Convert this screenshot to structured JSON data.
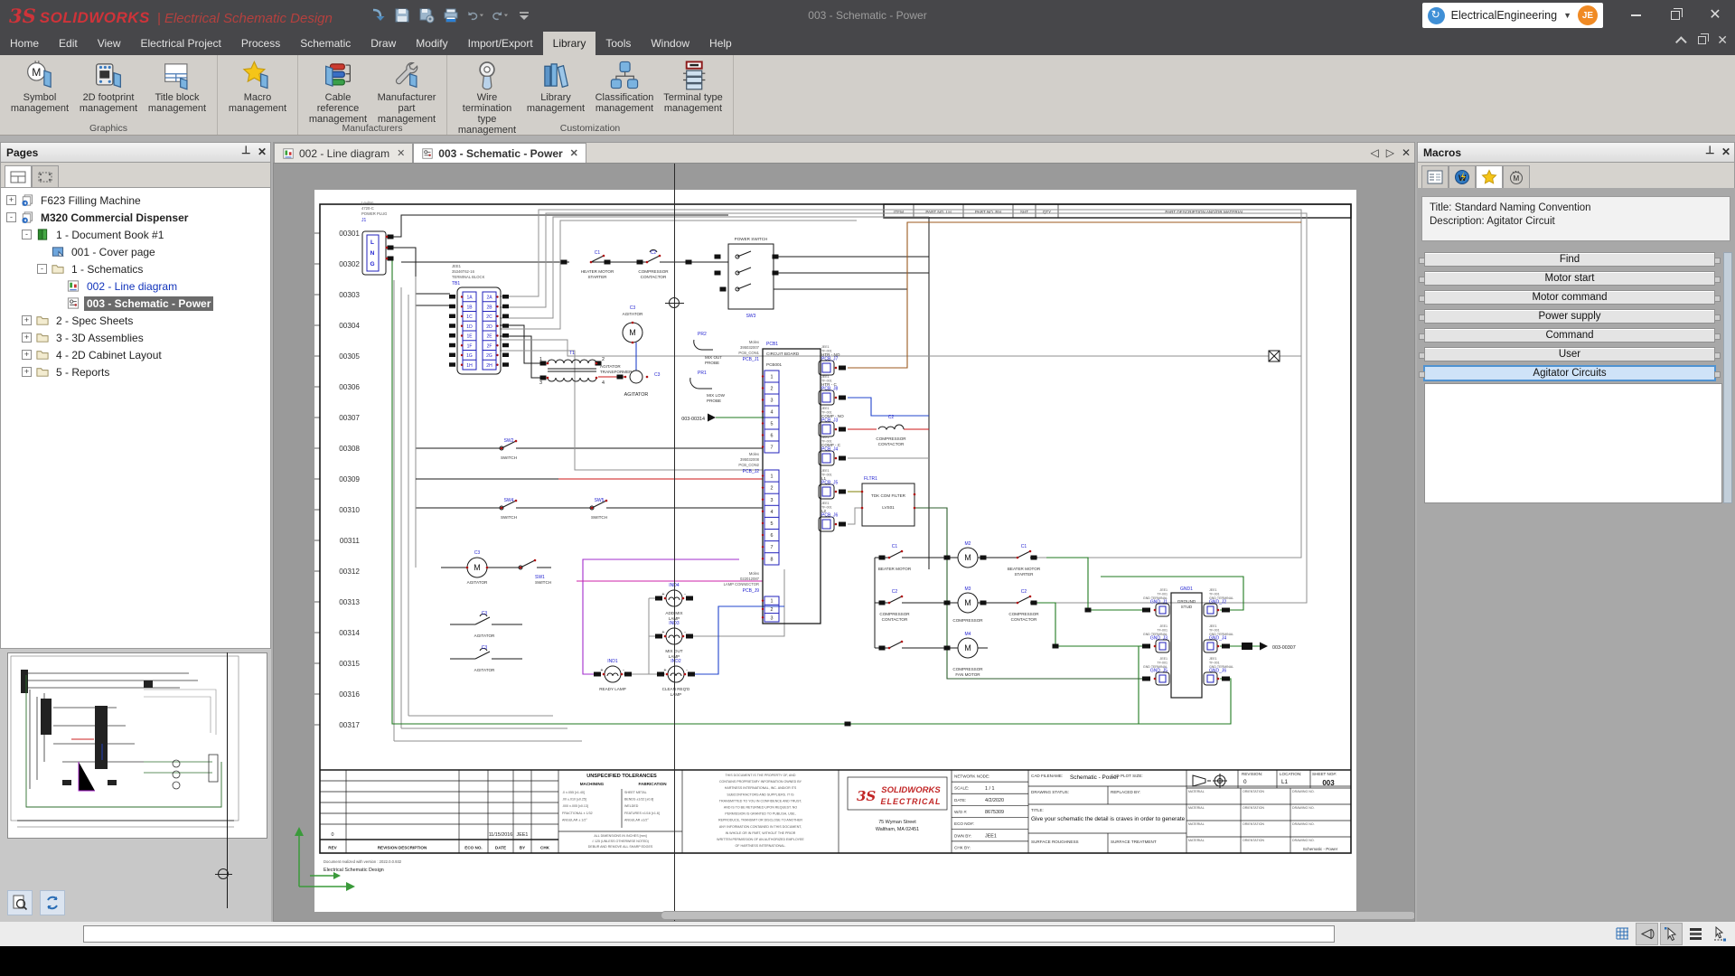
{
  "titlebar": {
    "logo_mark": "3S",
    "brand": "SOLIDWORKS",
    "app_title": "| Electrical Schematic Design",
    "document_title": "003 - Schematic - Power",
    "workspace": "ElectricalEngineering",
    "avatar_initials": "JE",
    "qat": [
      "import",
      "save",
      "save-all",
      "print",
      "undo",
      "redo",
      "customize"
    ]
  },
  "menubar": {
    "items": [
      "Home",
      "Edit",
      "View",
      "Electrical Project",
      "Process",
      "Schematic",
      "Draw",
      "Modify",
      "Import/Export",
      "Library",
      "Tools",
      "Window",
      "Help"
    ],
    "active": "Library"
  },
  "ribbon": {
    "groups": [
      {
        "label": "Graphics",
        "buttons": [
          {
            "line1": "Symbol",
            "line2": "management",
            "icon": "symbol"
          },
          {
            "line1": "2D footprint",
            "line2": "management",
            "icon": "footprint"
          },
          {
            "line1": "Title block",
            "line2": "management",
            "icon": "titleblock"
          }
        ]
      },
      {
        "label": "",
        "buttons": [
          {
            "line1": "Macro",
            "line2": "management",
            "icon": "macro"
          }
        ]
      },
      {
        "label": "Manufacturers",
        "buttons": [
          {
            "line1": "Cable reference",
            "line2": "management",
            "icon": "cable"
          },
          {
            "line1": "Manufacturer",
            "line2": "part management",
            "icon": "wrench"
          }
        ]
      },
      {
        "label": "Customization",
        "buttons": [
          {
            "line1": "Wire termination",
            "line2": "type management",
            "icon": "wireterm"
          },
          {
            "line1": "Library",
            "line2": "management",
            "icon": "library"
          },
          {
            "line1": "Classification",
            "line2": "management",
            "icon": "classification"
          },
          {
            "line1": "Terminal type",
            "line2": "management",
            "icon": "terminal"
          }
        ]
      }
    ]
  },
  "pages_panel": {
    "title": "Pages",
    "tree": [
      {
        "label": "F623 Filling Machine",
        "level": 0,
        "expander": "+",
        "icon": "project"
      },
      {
        "label": "M320 Commercial Dispenser",
        "level": 0,
        "expander": "-",
        "icon": "project",
        "bold": true
      },
      {
        "label": "1 - Document Book #1",
        "level": 1,
        "expander": "-",
        "icon": "book"
      },
      {
        "label": "001 - Cover page",
        "level": 2,
        "expander": "",
        "icon": "cover"
      },
      {
        "label": "1 - Schematics",
        "level": 2,
        "expander": "-",
        "icon": "folder"
      },
      {
        "label": "002 - Line diagram",
        "level": 3,
        "expander": "",
        "icon": "linediag",
        "link": true
      },
      {
        "label": "003 - Schematic - Power",
        "level": 3,
        "expander": "",
        "icon": "schematic",
        "selected": true
      },
      {
        "label": "2 - Spec Sheets",
        "level": 1,
        "expander": "+",
        "icon": "folder"
      },
      {
        "label": "3 - 3D Assemblies",
        "level": 1,
        "expander": "+",
        "icon": "folder"
      },
      {
        "label": "4 - 2D Cabinet Layout",
        "level": 1,
        "expander": "+",
        "icon": "folder"
      },
      {
        "label": "5 - Reports",
        "level": 1,
        "expander": "+",
        "icon": "folder"
      }
    ]
  },
  "document_tabs": [
    {
      "label": "002 - Line diagram",
      "icon": "linediag",
      "active": false
    },
    {
      "label": "003 - Schematic - Power",
      "icon": "schematic",
      "active": true
    }
  ],
  "macros_panel": {
    "title": "Macros",
    "info_title": "Title: Standard Naming Convention",
    "info_description": "Description: Agitator Circuit",
    "buttons": [
      "Find",
      "Motor start",
      "Motor command",
      "Power supply",
      "Command",
      "User",
      "Agitator Circuits"
    ],
    "selected": "Agitator Circuits"
  },
  "statusbar": {
    "command_value": "",
    "tools": [
      {
        "name": "grid",
        "active": false
      },
      {
        "name": "projection",
        "active": true
      },
      {
        "name": "snap-cursor",
        "active": true
      },
      {
        "name": "layers",
        "active": false
      },
      {
        "name": "measure-line",
        "active": false
      }
    ]
  },
  "schematic": {
    "wire_numbers": [
      "00301",
      "00302",
      "00303",
      "00304",
      "00305",
      "00306",
      "00307",
      "00308",
      "00309",
      "00310",
      "00311",
      "00312",
      "00313",
      "00314",
      "00315",
      "00316",
      "00317"
    ],
    "bom_columns": [
      "ITEM",
      "PART NO. LH",
      "PART NO. RH",
      "SHT",
      "QTY",
      "PART DESCRIPTION AND/OR MATERIAL"
    ],
    "motor_letter": "M",
    "polarity": {
      "plus": "+",
      "minus": "-"
    },
    "frame_refs": {
      "ref_in": "003-00314",
      "ref_out": "003-00307"
    },
    "components": {
      "j1": {
        "part": [
          "Leviton",
          "4720-C",
          "POWER PLUG"
        ],
        "ref": "J1",
        "pins": [
          "L",
          "N",
          "G"
        ]
      },
      "tb1": {
        "part": [
          "JEE1",
          "35346T62-16",
          "TERMINAL BLOCK"
        ],
        "ref": "TB1",
        "col1": [
          "1A",
          "1B",
          "1C",
          "1D",
          "1E",
          "1F",
          "1G",
          "1H"
        ],
        "col2": [
          "2A",
          "2B",
          "2C",
          "2D",
          "2E",
          "2F",
          "2G",
          "2H"
        ]
      },
      "c1_starter": {
        "ref": "C1",
        "caption": [
          "HEATER MOTOR",
          "STARTER"
        ]
      },
      "c2_contactor": {
        "ref": "C2",
        "caption": [
          "COMPRESSOR",
          "CONTACTOR"
        ]
      },
      "sw3": {
        "ref": "SW3",
        "caption": "POWER SWITCH"
      },
      "t1": {
        "ref": "T1",
        "caption": [
          "AGITATOR",
          "TRANSFORMER"
        ],
        "pins": [
          "1",
          "2",
          "3",
          "4"
        ]
      },
      "c3_motor": {
        "ref": "C3",
        "caption": "AGITATOR"
      },
      "c3_coil": {
        "ref": "C3",
        "caption": "AGITATOR"
      },
      "c3_contact": {
        "ref": "C3",
        "caption": "AGITATOR"
      },
      "pr2": {
        "ref": "PR2",
        "caption": [
          "MIX OUT",
          "PROBE"
        ]
      },
      "pr1": {
        "ref": "PR1",
        "caption": [
          "MIX LOW",
          "PROBE"
        ]
      },
      "pcb1": {
        "ref": "PCB1",
        "caption": "CIRCUIT BOARD",
        "sub": "PCB001"
      },
      "pcb_con1": {
        "part": [
          "Molex",
          "395032007",
          "PCB_CON1"
        ],
        "ref": "PCB_J1",
        "pins": [
          "1",
          "2",
          "3",
          "4",
          "5",
          "6",
          "7"
        ]
      },
      "pcb_con2": {
        "part": [
          "Molex",
          "395032008",
          "PCB_CON2"
        ],
        "ref": "PCB_J2",
        "pins": [
          "1",
          "2",
          "3",
          "4",
          "5",
          "6",
          "7",
          "8"
        ]
      },
      "lamp_conn": {
        "part": [
          "Molex",
          "022012087",
          "LAMP CONNECTOR"
        ],
        "ref": "PCB_J9",
        "pins": [
          "1",
          "2",
          "3"
        ]
      },
      "pcb_terminals": [
        {
          "part": "JEE1",
          "series": "TF-001",
          "signal": "HTR - NO",
          "ref": "PCB_J7"
        },
        {
          "part": "JEE1",
          "series": "TF-001",
          "signal": "HTR - C",
          "ref": "PCB_J8"
        },
        {
          "part": "JEE1",
          "series": "TF-001",
          "signal": "COMP - NO",
          "ref": "PCB_J3"
        },
        {
          "part": "JEE1",
          "series": "TF-001",
          "signal": "COMP - C",
          "ref": "PCB_J4"
        },
        {
          "part": "JEE1",
          "series": "TF-001",
          "signal": "L1",
          "ref": "PCB_J5"
        },
        {
          "part": "JEE1",
          "series": "TF-001",
          "signal": "L2",
          "ref": "PCB_J6"
        }
      ],
      "c2_coil": {
        "ref": "C2",
        "caption": [
          "COMPRESSOR",
          "CONTACTOR"
        ]
      },
      "fltr1": {
        "ref": "FLTR1",
        "caption": "TDK COM FILTER",
        "sub": "LVS01"
      },
      "sw1": {
        "ref": "SW1",
        "caption": "SWITCH"
      },
      "sw2": {
        "ref": "SW2",
        "caption": "SWITCH"
      },
      "sw4": {
        "ref": "SW4",
        "caption": "SWITCH"
      },
      "sw5": {
        "ref": "SW5",
        "caption": "SWITCH"
      },
      "ind1": {
        "ref": "IND1",
        "caption": [
          "READY LAMP"
        ]
      },
      "ind2": {
        "ref": "IND2",
        "caption": [
          "CLEAN REQ'D",
          "LAMP"
        ]
      },
      "ind3": {
        "ref": "IND3",
        "caption": [
          "MIX OUT",
          "LAMP"
        ]
      },
      "ind4": {
        "ref": "IND4",
        "caption": [
          "ADD MIX",
          "LAMP"
        ]
      },
      "m2": {
        "ref": "M2",
        "caption": "BEATER MOTOR"
      },
      "m3": {
        "ref": "M3",
        "caption": "COMPRESSOR"
      },
      "m4": {
        "ref": "M4",
        "caption": [
          "COMPRESSOR",
          "FAN MOTOR"
        ]
      },
      "c1_left": {
        "ref": "C1",
        "caption": "BEATER MOTOR"
      },
      "c1_right": {
        "ref": "C1",
        "caption": [
          "BEATER MOTOR",
          "STARTER"
        ]
      },
      "c2_left": {
        "ref": "C2",
        "caption": [
          "COMPRESSOR",
          "CONTACTOR"
        ]
      },
      "c2_right": {
        "ref": "C2",
        "caption": [
          "COMPRESSOR",
          "CONTACTOR"
        ]
      },
      "gnd1": {
        "ref": "GND1",
        "caption": [
          "GROUND",
          "STUD"
        ]
      },
      "gnd_terminals": [
        {
          "part": "JEE1",
          "series": "TF-001",
          "caption": "GND TERMINAL",
          "ref": "GND_J1"
        },
        {
          "part": "JEE1",
          "series": "TF-001",
          "caption": "GND TERMINAL",
          "ref": "GND_J2"
        },
        {
          "part": "JEE1",
          "series": "TF-001",
          "caption": "GND TERMINAL",
          "ref": "GND_J3"
        },
        {
          "part": "JEE1",
          "series": "TF-001",
          "caption": "GND TERMINAL",
          "ref": "GND_J4"
        },
        {
          "part": "JEE1",
          "series": "TF-001",
          "caption": "GND TERMINAL",
          "ref": "GND_J5"
        },
        {
          "part": "JEE1",
          "series": "TF-001",
          "caption": "GND TERMINAL",
          "ref": "GND_J6"
        }
      ]
    },
    "title_block": {
      "revision_table": {
        "headers": [
          "REV",
          "REVISION DESCRIPTION",
          "ECO NO.",
          "DATE",
          "BY",
          "CHK"
        ],
        "row": {
          "rev": "0",
          "date": "11/15/2016",
          "by": "JEE1"
        }
      },
      "tolerances": {
        "title": "UNSPECIFIED TOLERANCES",
        "machining_label": "MACHINING",
        "fabrication_label": "FABRICATION",
        "machining": [
          ".0      ±.055  [±1.40]",
          ".00     ±.010  [±0.25]",
          ".000   ±.005  [±0.13]",
          "FRACTIONAL ± 1/32",
          "ANGULAR  ± 1/2°"
        ],
        "fabrication": [
          "SHEET METAL",
          "BENDS     ±1/32  [±0.8]",
          "WELDED",
          "FEATURES  ±1/16  [±1.6]",
          "ANGULAR   ±1/2°"
        ],
        "notes": [
          "ALL DIMENSIONS IN INCHES [mm]",
          "√ 125 (UNLESS OTHERWISE NOTED)",
          "DEBUR AND REMOVE ALL SHARP EDGES"
        ]
      },
      "proprietary": [
        "THIS DOCUMENT IS THE PROPERTY OF, AND",
        "CONTAINS PROPRIETARY INFORMATION OWNED BY",
        "HARTNESS INTERNATIONAL, INC. AND/OR ITS",
        "SUBCONTRACTORS AND SUPPLIERS. IT IS",
        "TRANSMITTED TO YOU IN CONFIDENCE AND TRUST,",
        "AND IS TO BE RETURNED UPON REQUEST. NO",
        "PERMISSION IS GRANTED TO PUBLISH, USE,",
        "REPRODUCE, TRANSMIT OR DISCLOSE TO ANOTHER",
        "ANY INFORMATION CONTAINED IN THIS DOCUMENT,",
        "IN WHOLE OR IN PART, WITHOUT THE PRIOR",
        "WRITTEN PERMISSION OF AN AUTHORIZED EMPLOYEE",
        "OF HARTNESS INTERNATIONAL."
      ],
      "logo": {
        "mark": "3S",
        "brand": "SOLIDWORKS",
        "sub": "ELECTRICAL",
        "address": [
          "75 Wyman Street",
          "Waltham, MA 02451"
        ]
      },
      "fields": [
        {
          "label": "NETWORK NODE:",
          "value": ""
        },
        {
          "label": "SCALE:",
          "value": "1 / 1"
        },
        {
          "label": "DATE:",
          "value": "4/2/2020"
        },
        {
          "label": "W/O #:",
          "value": "8675309"
        },
        {
          "label": "ECO NO#:",
          "value": ""
        },
        {
          "label": "DWN BY:",
          "value": "JEE1"
        },
        {
          "label": "CHK BY:",
          "value": ""
        }
      ],
      "cad_filename_label": "CAD FILENAME:",
      "cad_filename": "Schematic - Power",
      "cad_plot_size": "CAD PLOT SIZE:",
      "drawing_status": "DRAWING STATUS:",
      "replaced_by": "REPLACED BY:",
      "title_label": "TITLE:",
      "title": "Give your schematic the detail is craves in order to generate",
      "surface_roughness": "SURFACE ROUGHNESS",
      "surface_treatment": "SURFACE TREATMENT",
      "revision_label": "REVISION:",
      "revision": "0",
      "location_label": "LOCATION:",
      "location": "L1",
      "sheet_label": "SHEET NO#:",
      "sheet": "003",
      "grid_headers": [
        "MATERIAL",
        "ORIENTATION",
        "DRAWING NO."
      ],
      "drawing_no_value": "Schematic - Power",
      "footer": [
        "Document realized with version :  2022.0.0.932",
        "Electrical Schematic Design"
      ]
    }
  }
}
